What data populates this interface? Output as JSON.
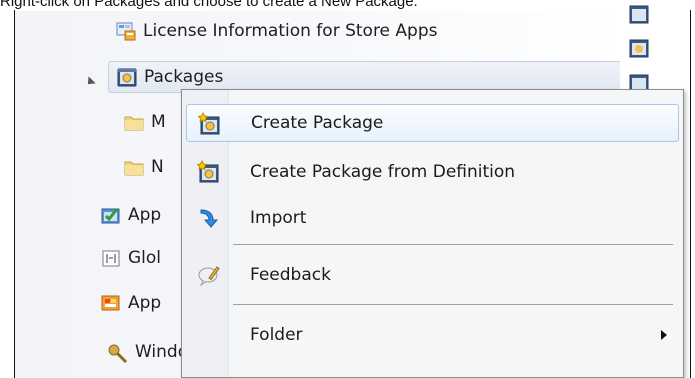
{
  "caption": "Right-click on Packages and choose to create a New Package.",
  "tree": {
    "items": [
      {
        "label": "License Information for Store Apps",
        "icon": "license-info-icon"
      },
      {
        "label": "Packages",
        "icon": "package-icon",
        "selected": true,
        "expanded": true
      },
      {
        "label": "M",
        "icon": "folder-icon"
      },
      {
        "label": "N",
        "icon": "folder-icon"
      },
      {
        "label": "App",
        "icon": "application-icon"
      },
      {
        "label": "Glol",
        "icon": "global-conditions-icon"
      },
      {
        "label": "App",
        "icon": "app-virtualization-icon"
      },
      {
        "label": "Windows Sideloading Keys",
        "icon": "sideloading-keys-icon"
      }
    ]
  },
  "context_menu": {
    "items": [
      {
        "label": "Create Package",
        "icon": "create-package-icon",
        "highlighted": true
      },
      {
        "label": "Create Package from Definition",
        "icon": "create-package-definition-icon"
      },
      {
        "label": "Import",
        "icon": "import-arrow-icon"
      },
      {
        "label": "Feedback",
        "icon": "feedback-icon"
      },
      {
        "label": "Folder",
        "icon": "",
        "has_submenu": true
      }
    ]
  },
  "colors": {
    "menu_background": "#f5f6f7",
    "highlight_border": "#a8c8e8",
    "tree_background": "#f2f4f8",
    "folder": "#f3d27a"
  }
}
